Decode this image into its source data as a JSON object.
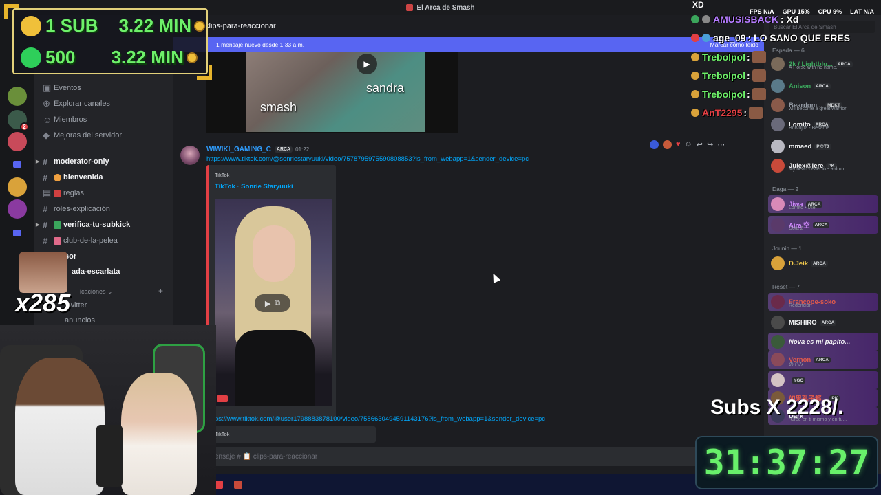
{
  "window": {
    "title": "El Arca de Smash"
  },
  "channel_header": {
    "name": "clips-para-reaccionar"
  },
  "new_messages_bar": {
    "text": "1 mensaje nuevo desde 1:33 a.m.",
    "action": "Marcar como leído"
  },
  "sidebar": {
    "items": [
      {
        "label": "Eventos"
      },
      {
        "label": "Explorar canales"
      },
      {
        "label": "Miembros"
      },
      {
        "label": "Mejoras del servidor"
      }
    ],
    "channels": [
      {
        "label": "moderator-only"
      },
      {
        "label": "bienvenida"
      },
      {
        "label": "reglas"
      },
      {
        "label": "roles-explicación"
      },
      {
        "label": "verifica-tu-subkick"
      },
      {
        "label": "club-de-la-pelea"
      },
      {
        "label": "sor"
      },
      {
        "label": "ada-escarlata"
      },
      {
        "label": "witter"
      },
      {
        "label": "anuncios"
      }
    ],
    "category": "icaciones"
  },
  "clip1": {
    "captions": [
      "smash",
      "sandra"
    ]
  },
  "message": {
    "author": "WIWIKI_GAMING_C",
    "tag": "ARCA",
    "time": "01:22",
    "link": "https://www.tiktok.com/@sonriestaryuuki/video/7578795975590808853?is_from_webapp=1&sender_device=pc",
    "embed_provider": "TikTok",
    "embed_title": "TikTok · Sonrie Staryuuki"
  },
  "message2": {
    "link": "ps://www.tiktok.com/@user1798883878100/video/7586630494591143176?is_from_webapp=1&sender_device=pc",
    "embed_provider": "TikTok"
  },
  "composer": {
    "placeholder": "ensaje # 📋 clips-para-reaccionar"
  },
  "members": {
    "search_placeholder": "Buscar El Arca de Smash",
    "roles": [
      {
        "header": "Espada — 6"
      },
      {
        "header": "Daga — 2"
      },
      {
        "header": "Jounin — 1"
      },
      {
        "header": "Reset — 7"
      }
    ],
    "list": [
      {
        "name": "2k / Lightblu...",
        "tag": "ARCA",
        "status": "A Horse with no name.",
        "color": "#3ba55c"
      },
      {
        "name": "Anison",
        "tag": "ARCA",
        "status": "",
        "color": "#3ba55c"
      },
      {
        "name": "Beardom...",
        "tag": "MDKT",
        "status": "will become a great warrior",
        "color": "#949ba4"
      },
      {
        "name": "Lomito",
        "tag": "ARCA",
        "status": "Borvujita - Bésame",
        "color": "#f2f3f5"
      },
      {
        "name": "mmaed",
        "tag": "P@T0",
        "status": "",
        "color": "#f2f3f5"
      },
      {
        "name": "Julex@lere",
        "tag": "PK",
        "status": "My heart beats like a drum",
        "color": "#f2f3f5"
      },
      {
        "name": "Jiwa",
        "tag": "ARCA",
        "status": "Lomito • Miel",
        "color": "#d28bff"
      },
      {
        "name": "Aira 空",
        "tag": "ARCA",
        "status": "Dota 2",
        "color": "#d28bff"
      },
      {
        "name": "D.Jeik",
        "tag": "ARCA",
        "status": "",
        "color": "#f2c94c"
      },
      {
        "name": "Francope-soko",
        "tag": "",
        "status": "Redención",
        "color": "#e05a4c"
      },
      {
        "name": "MISHIRO",
        "tag": "ARCA",
        "status": "",
        "color": "#f2f3f5"
      },
      {
        "name": "Nova es mi papito...",
        "tag": "",
        "status": "",
        "color": "#f2f3f5"
      },
      {
        "name": "Vernon",
        "tag": "ARCA",
        "status": "のぞみ",
        "color": "#e05a4c"
      },
      {
        "name": "",
        "tag": "YGO",
        "status": "",
        "color": "#e05a4c"
      },
      {
        "name": "如果孔子都...",
        "tag": "PK",
        "status": "",
        "color": "#e05a4c"
      },
      {
        "name": "Dark",
        "tag": "",
        "status": "\"Cree en ti mismo y en tu...",
        "color": "#f2f3f5"
      }
    ]
  },
  "overlay": {
    "sub_rows": [
      {
        "left": "1 SUB",
        "right": "3.22 MIN"
      },
      {
        "left": "500",
        "right": "3.22 MIN"
      }
    ],
    "multiplier": "x285",
    "stats": [
      "FPS N/A",
      "GPU 15%",
      "CPU 9%",
      "LAT N/A"
    ],
    "xd": "XD",
    "chat": [
      {
        "user": "AMUSISBACK",
        "text": ": Xd",
        "color": "#b57cff"
      },
      {
        "user": "age_09",
        "text": ": LO SANO QUE ERES",
        "color": "#ffffff"
      },
      {
        "user": "Trebolpol",
        "text": ":",
        "color": "#6ef06a"
      },
      {
        "user": "Trebolpol",
        "text": ":",
        "color": "#6ef06a"
      },
      {
        "user": "Trebolpol",
        "text": ":",
        "color": "#6ef06a"
      },
      {
        "user": "AnT2295",
        "text": ":",
        "color": "#e23f44"
      }
    ],
    "subs_label": "Subs X",
    "subs_value": "2228/.",
    "timer": "31:37:27"
  }
}
